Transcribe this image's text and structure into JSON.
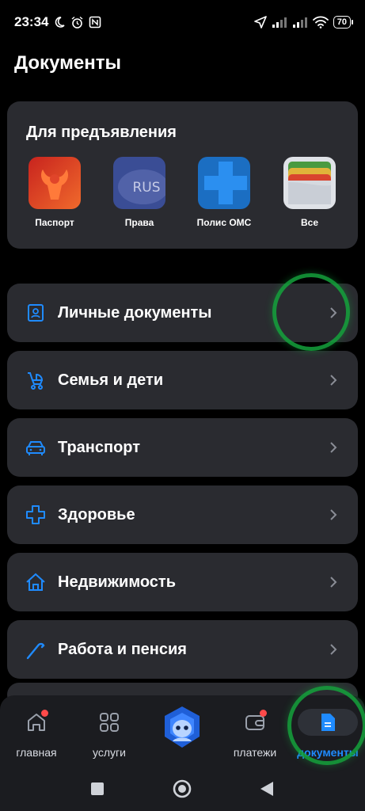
{
  "status_bar": {
    "time": "23:34",
    "battery": "70",
    "icons": [
      "moon-icon",
      "alarm-icon",
      "nfc-icon",
      "location-arrow-icon",
      "signal-icon",
      "signal-icon",
      "wifi-icon",
      "battery-icon"
    ]
  },
  "page": {
    "title": "Документы"
  },
  "present": {
    "title": "Для предъявления",
    "docs": [
      {
        "label": "Паспорт",
        "icon": "passport-icon",
        "color": "#e0452a"
      },
      {
        "label": "Права",
        "icon": "driving-license-icon",
        "color": "#3b4e9a",
        "badge": "RUS"
      },
      {
        "label": "Полис ОМС",
        "icon": "medical-policy-icon",
        "color": "#1e7bd6"
      },
      {
        "label": "Все",
        "icon": "wallet-icon",
        "color": "#d9dde3"
      }
    ]
  },
  "categories": [
    {
      "label": "Личные документы",
      "icon": "id-card-icon"
    },
    {
      "label": "Семья и дети",
      "icon": "stroller-icon"
    },
    {
      "label": "Транспорт",
      "icon": "car-icon"
    },
    {
      "label": "Здоровье",
      "icon": "medical-cross-icon"
    },
    {
      "label": "Недвижимость",
      "icon": "house-icon"
    },
    {
      "label": "Работа и пенсия",
      "icon": "cane-icon"
    }
  ],
  "bottom_nav": {
    "items": [
      {
        "label": "главная",
        "icon": "home-icon",
        "badge": true
      },
      {
        "label": "услуги",
        "icon": "grid-icon",
        "badge": false
      },
      {
        "label": "",
        "icon": "assistant-robot-icon",
        "badge": false
      },
      {
        "label": "платежи",
        "icon": "payment-wallet-icon",
        "badge": true
      },
      {
        "label": "документы",
        "icon": "document-icon",
        "badge": false,
        "active": true
      }
    ]
  },
  "colors": {
    "accent": "#1f8bff",
    "card": "#2a2b30",
    "background": "#000000",
    "badge": "#ff4a4a",
    "highlight": "#14a33c"
  }
}
